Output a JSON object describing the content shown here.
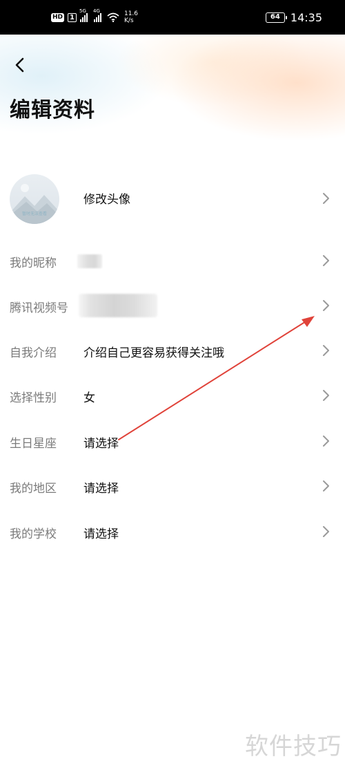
{
  "status_bar": {
    "hd_label": "HD",
    "hd_sim": "1",
    "net_1": "5G",
    "net_2": "4G",
    "speed_value": "11.6",
    "speed_unit": "K/s",
    "battery": "64",
    "time": "14:35",
    "icons": [
      "signal-icon",
      "wifi-icon",
      "battery-icon"
    ]
  },
  "header": {
    "back_icon": "back-arrow-icon",
    "title": "编辑资料"
  },
  "avatar": {
    "label": "修改头像",
    "placeholder_caption": "暂时无法查看"
  },
  "fields": [
    {
      "label": "我的昵称",
      "value": ""
    },
    {
      "label": "腾讯视频号",
      "value": ""
    },
    {
      "label": "自我介绍",
      "value": "介绍自己更容易获得关注哦"
    },
    {
      "label": "选择性别",
      "value": "女"
    },
    {
      "label": "生日星座",
      "value": "请选择"
    },
    {
      "label": "我的地区",
      "value": "请选择"
    },
    {
      "label": "我的学校",
      "value": "请选择"
    }
  ],
  "annotation": {
    "color": "#e0433a"
  },
  "watermark": "软件技巧",
  "colors": {
    "label_gray": "#7b7b7b",
    "text": "#111111",
    "chevron": "#9a9a9a"
  }
}
